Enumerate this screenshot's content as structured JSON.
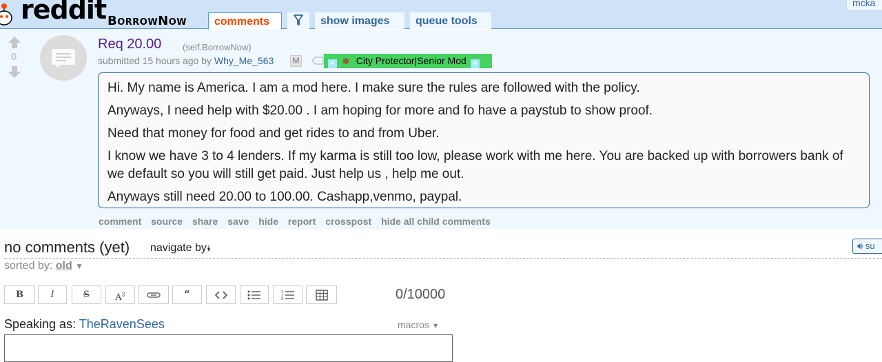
{
  "header": {
    "logo_text": "reddit",
    "subreddit": "BorrowNow",
    "tabs": {
      "comments": "comments",
      "show_images": "show images",
      "queue_tools": "queue tools"
    },
    "user_partial": "mcka"
  },
  "post": {
    "score": "0",
    "title": "Req 20.00",
    "domain": "(self.BorrowNow)",
    "submitted_prefix": "submitted 15 hours ago by",
    "author": "Why_Me_563",
    "mod_marker": "M",
    "flair_text": "City Protector|Senior Mod",
    "body": [
      "Hi. My name is America. I am a mod here. I make sure the rules are followed with the policy.",
      "Anyways, I need help with $20.00 . I am hoping for more and fo have a paystub to show proof.",
      "Need that money for food and get rides to and from Uber.",
      "I know we have 3 to 4 lenders. If my karma is still too low, please work with me here. You are backed up with borrowers bank of we default so you will still get paid. Just help us , help me out.",
      "Anyways still need 20.00 to 100.00. Cashapp,venmo, paypal."
    ],
    "buttons": [
      "comment",
      "source",
      "share",
      "save",
      "hide",
      "report",
      "crosspost",
      "hide all child comments"
    ]
  },
  "comments": {
    "title": "no comments (yet)",
    "navigate_label": "navigate by",
    "speak_button": "su",
    "sorted_label": "sorted by:",
    "sorted_value": "old"
  },
  "editor": {
    "char_counter": "0/10000",
    "speaking_label": "Speaking as:",
    "speaking_user": "TheRavenSees",
    "macros_label": "macros",
    "toolbar_icons": [
      "bold-icon",
      "italic-icon",
      "strikethrough-icon",
      "superscript-icon",
      "link-icon",
      "quote-icon",
      "code-icon",
      "bulleted-list-icon",
      "numbered-list-icon",
      "table-icon"
    ]
  },
  "colors": {
    "header_bg": "#cee3f8",
    "post_bg": "#eff7ff",
    "active_tab": "#ff4500",
    "title": "#551a8b",
    "link": "#336699",
    "flair_bg": "#46d160"
  }
}
